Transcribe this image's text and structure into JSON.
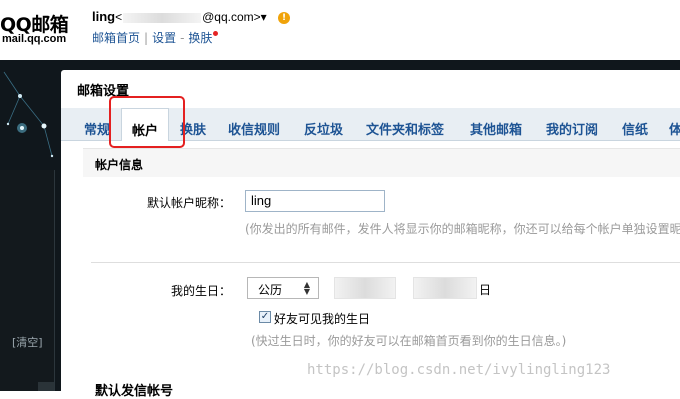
{
  "header": {
    "logo": "QQ邮箱",
    "logo_domain": "mail.qq.com",
    "user_name": "ling",
    "email_prefix": "<",
    "email_suffix": "@qq.com>",
    "user_menu_arrow": "▾",
    "alert_icon": "!",
    "links": {
      "home": "邮箱首页",
      "separator": "|",
      "settings": "设置",
      "dash": "-",
      "skin": "换肤"
    }
  },
  "sidebar": {
    "clear_button": "[清空]"
  },
  "settings": {
    "title": "邮箱设置",
    "tabs": [
      {
        "label": "常规"
      },
      {
        "label": "帐户",
        "active": true
      },
      {
        "label": "换肤"
      },
      {
        "label": "收信规则"
      },
      {
        "label": "反垃圾"
      },
      {
        "label": "文件夹和标签"
      },
      {
        "label": "其他邮箱"
      },
      {
        "label": "我的订阅"
      },
      {
        "label": "信纸"
      },
      {
        "label": "体"
      }
    ],
    "account_info": {
      "section_title": "帐户信息",
      "nickname_label": "默认帐户昵称：",
      "nickname_value": "ling",
      "nickname_hint": "(你发出的所有邮件，发件人将显示你的邮箱昵称，你还可以给每个帐户单独设置昵"
    },
    "birthday": {
      "label": "我的生日：",
      "calendar_value": "公历",
      "day_suffix": "日",
      "friends_visible_label": "好友可见我的生日",
      "friends_visible_checked": true,
      "hint": "(快过生日时，你的好友可以在邮箱首页看到你的生日信息。)"
    },
    "next_section_title": "默认发信帐号"
  },
  "watermark": "https://blog.csdn.net/ivylingling123",
  "colors": {
    "link": "#1e5494",
    "highlight": "#e42020",
    "dark_background": "#10171c"
  }
}
